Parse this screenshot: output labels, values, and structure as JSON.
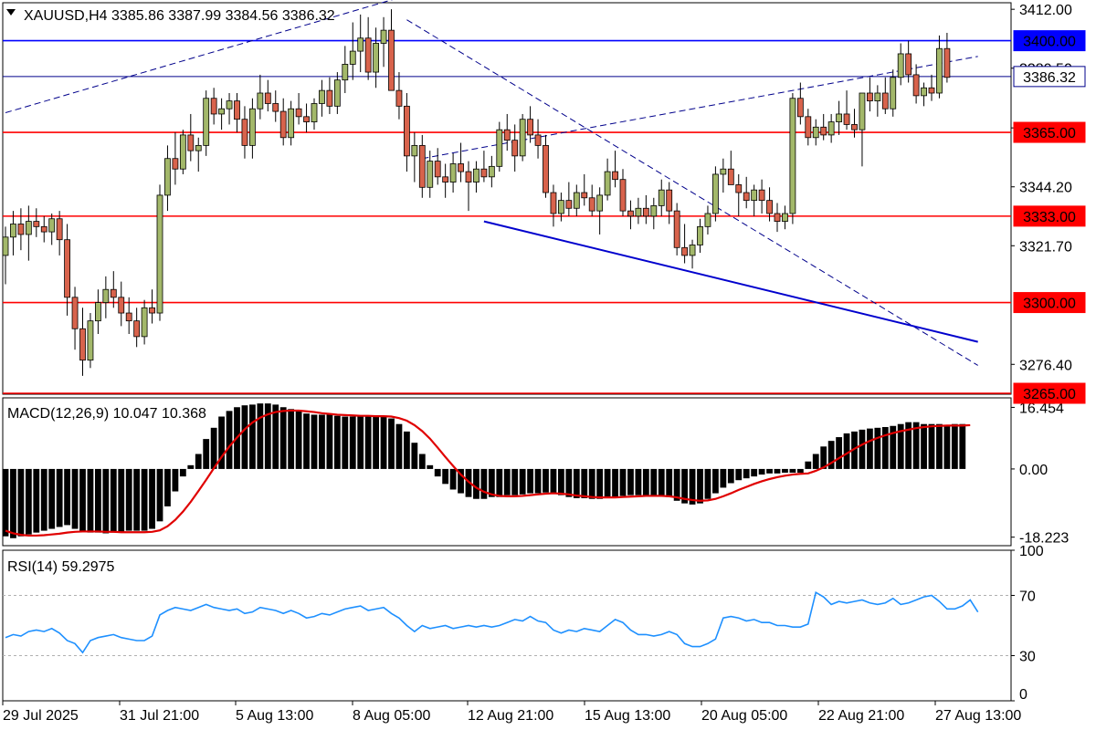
{
  "header": {
    "symbol_text": "XAUUSD,H4  3385.86 3387.99 3384.56 3386.32",
    "menu_icon": "triangle-down-icon"
  },
  "colors": {
    "bull_candle": "#a3b86a",
    "bear_candle": "#d8634c",
    "candle_outline": "#000000",
    "support_resistance_line": "#ff0000",
    "level_3400_line": "#0000ff",
    "current_price_line": "#00008b",
    "trendline": "#0000cd",
    "channel_dashed": "#00008b",
    "macd_histogram": "#000000",
    "macd_signal": "#e00000",
    "rsi_line": "#1e90ff",
    "price_label_red": "#ff0000",
    "price_label_blue": "#0000ff",
    "price_label_current": "#00008b"
  },
  "chart_data": [
    {
      "type": "candlestick",
      "title": "",
      "y_axis": {
        "min": 3265.0,
        "max": 3414.5,
        "ticks": [
          "3412.00",
          "3389.50",
          "3366.70",
          "3344.20",
          "3321.70",
          "3276.40"
        ]
      },
      "x_axis": {
        "ticks": [
          "29 Jul 2025",
          "31 Jul 21:00",
          "5 Aug 13:00",
          "8 Aug 05:00",
          "12 Aug 21:00",
          "15 Aug 13:00",
          "20 Aug 05:00",
          "22 Aug 21:00",
          "27 Aug 13:00"
        ]
      },
      "horizontal_levels": [
        {
          "label": "3400.00",
          "value": 3400.0,
          "kind": "blue"
        },
        {
          "label": "3386.32",
          "value": 3386.32,
          "kind": "current"
        },
        {
          "label": "3365.00",
          "value": 3365.0,
          "kind": "red"
        },
        {
          "label": "3333.00",
          "value": 3333.0,
          "kind": "red"
        },
        {
          "label": "3300.00",
          "value": 3300.0,
          "kind": "red"
        },
        {
          "label": "3265.00",
          "value": 3265.0,
          "kind": "red"
        }
      ],
      "candles": [
        [
          3318,
          3329,
          3307,
          3325
        ],
        [
          3325,
          3335,
          3318,
          3330
        ],
        [
          3330,
          3336,
          3320,
          3326
        ],
        [
          3326,
          3337,
          3316,
          3331
        ],
        [
          3331,
          3336,
          3325,
          3329
        ],
        [
          3329,
          3333,
          3323,
          3327
        ],
        [
          3327,
          3334,
          3322,
          3332
        ],
        [
          3332,
          3335,
          3318,
          3324
        ],
        [
          3324,
          3330,
          3295,
          3302
        ],
        [
          3302,
          3306,
          3282,
          3290
        ],
        [
          3290,
          3298,
          3272,
          3278
        ],
        [
          3278,
          3296,
          3275,
          3293
        ],
        [
          3293,
          3305,
          3288,
          3300
        ],
        [
          3300,
          3310,
          3294,
          3305
        ],
        [
          3305,
          3312,
          3298,
          3302
        ],
        [
          3302,
          3308,
          3291,
          3296
        ],
        [
          3296,
          3302,
          3288,
          3293
        ],
        [
          3293,
          3298,
          3283,
          3287
        ],
        [
          3287,
          3301,
          3284,
          3298
        ],
        [
          3298,
          3305,
          3292,
          3296
        ],
        [
          3296,
          3345,
          3293,
          3341
        ],
        [
          3341,
          3360,
          3335,
          3355
        ],
        [
          3355,
          3365,
          3345,
          3351
        ],
        [
          3351,
          3366,
          3349,
          3364
        ],
        [
          3364,
          3372,
          3354,
          3358
        ],
        [
          3358,
          3363,
          3350,
          3360
        ],
        [
          3360,
          3381,
          3356,
          3378
        ],
        [
          3378,
          3382,
          3368,
          3372
        ],
        [
          3372,
          3378,
          3366,
          3374
        ],
        [
          3374,
          3380,
          3368,
          3377
        ],
        [
          3377,
          3380,
          3365,
          3370
        ],
        [
          3370,
          3375,
          3355,
          3360
        ],
        [
          3360,
          3378,
          3355,
          3374
        ],
        [
          3374,
          3387,
          3370,
          3380
        ],
        [
          3380,
          3385,
          3373,
          3376
        ],
        [
          3376,
          3381,
          3369,
          3373
        ],
        [
          3373,
          3378,
          3360,
          3363
        ],
        [
          3363,
          3377,
          3360,
          3374
        ],
        [
          3374,
          3380,
          3368,
          3371
        ],
        [
          3371,
          3376,
          3365,
          3369
        ],
        [
          3369,
          3378,
          3366,
          3376
        ],
        [
          3376,
          3385,
          3371,
          3381
        ],
        [
          3381,
          3386,
          3372,
          3375
        ],
        [
          3375,
          3388,
          3372,
          3385
        ],
        [
          3385,
          3398,
          3380,
          3391
        ],
        [
          3391,
          3407,
          3385,
          3396
        ],
        [
          3396,
          3410,
          3388,
          3401
        ],
        [
          3401,
          3409,
          3385,
          3388
        ],
        [
          3388,
          3405,
          3382,
          3399
        ],
        [
          3399,
          3409,
          3390,
          3404
        ],
        [
          3404,
          3412,
          3393,
          3381
        ],
        [
          3381,
          3388,
          3370,
          3375
        ],
        [
          3375,
          3380,
          3350,
          3356
        ],
        [
          3356,
          3365,
          3346,
          3360
        ],
        [
          3360,
          3364,
          3340,
          3344
        ],
        [
          3344,
          3358,
          3340,
          3354
        ],
        [
          3354,
          3359,
          3345,
          3348
        ],
        [
          3348,
          3353,
          3340,
          3346
        ],
        [
          3346,
          3357,
          3342,
          3353
        ],
        [
          3353,
          3361,
          3346,
          3350
        ],
        [
          3350,
          3354,
          3335,
          3346
        ],
        [
          3346,
          3354,
          3342,
          3351
        ],
        [
          3351,
          3358,
          3346,
          3348
        ],
        [
          3348,
          3356,
          3344,
          3352
        ],
        [
          3352,
          3369,
          3350,
          3366
        ],
        [
          3366,
          3372,
          3358,
          3362
        ],
        [
          3362,
          3368,
          3350,
          3356
        ],
        [
          3356,
          3372,
          3354,
          3370
        ],
        [
          3370,
          3375,
          3361,
          3364
        ],
        [
          3364,
          3370,
          3355,
          3360
        ],
        [
          3360,
          3364,
          3340,
          3342
        ],
        [
          3342,
          3345,
          3329,
          3334
        ],
        [
          3334,
          3342,
          3331,
          3339
        ],
        [
          3339,
          3346,
          3333,
          3336
        ],
        [
          3336,
          3345,
          3333,
          3342
        ],
        [
          3342,
          3349,
          3337,
          3340
        ],
        [
          3340,
          3345,
          3333,
          3335
        ],
        [
          3335,
          3344,
          3326,
          3341
        ],
        [
          3341,
          3355,
          3339,
          3350
        ],
        [
          3350,
          3358,
          3344,
          3347
        ],
        [
          3347,
          3351,
          3333,
          3335
        ],
        [
          3335,
          3339,
          3328,
          3333
        ],
        [
          3333,
          3340,
          3330,
          3336
        ],
        [
          3336,
          3341,
          3330,
          3333
        ],
        [
          3333,
          3340,
          3328,
          3337
        ],
        [
          3337,
          3347,
          3333,
          3343
        ],
        [
          3343,
          3346,
          3330,
          3335
        ],
        [
          3335,
          3338,
          3318,
          3321
        ],
        [
          3321,
          3330,
          3315,
          3318
        ],
        [
          3318,
          3324,
          3313,
          3322
        ],
        [
          3322,
          3332,
          3319,
          3329
        ],
        [
          3329,
          3337,
          3326,
          3334
        ],
        [
          3334,
          3352,
          3331,
          3349
        ],
        [
          3349,
          3355,
          3342,
          3351
        ],
        [
          3351,
          3358,
          3346,
          3345
        ],
        [
          3345,
          3349,
          3333,
          3342
        ],
        [
          3342,
          3348,
          3336,
          3339
        ],
        [
          3339,
          3345,
          3333,
          3343
        ],
        [
          3343,
          3347,
          3334,
          3339
        ],
        [
          3339,
          3344,
          3331,
          3334
        ],
        [
          3334,
          3338,
          3327,
          3331
        ],
        [
          3331,
          3337,
          3328,
          3334
        ],
        [
          3334,
          3380,
          3330,
          3378
        ],
        [
          3378,
          3384,
          3368,
          3371
        ],
        [
          3371,
          3374,
          3360,
          3363
        ],
        [
          3363,
          3370,
          3360,
          3367
        ],
        [
          3367,
          3372,
          3362,
          3364
        ],
        [
          3364,
          3372,
          3361,
          3369
        ],
        [
          3369,
          3377,
          3364,
          3372
        ],
        [
          3372,
          3381,
          3366,
          3368
        ],
        [
          3368,
          3374,
          3363,
          3366
        ],
        [
          3366,
          3372,
          3352,
          3380
        ],
        [
          3380,
          3386,
          3373,
          3377
        ],
        [
          3377,
          3383,
          3371,
          3380
        ],
        [
          3380,
          3386,
          3372,
          3374
        ],
        [
          3374,
          3389,
          3371,
          3386
        ],
        [
          3386,
          3399,
          3383,
          3395
        ],
        [
          3395,
          3400,
          3384,
          3387
        ],
        [
          3387,
          3391,
          3376,
          3379
        ],
        [
          3379,
          3384,
          3375,
          3382
        ],
        [
          3382,
          3387,
          3377,
          3380
        ],
        [
          3380,
          3402,
          3378,
          3397
        ],
        [
          3397,
          3403,
          3384,
          3386
        ]
      ]
    },
    {
      "type": "bar",
      "title": "MACD(12,26,9) 10.047 10.368",
      "y_axis": {
        "ticks": [
          "16.454",
          "0.00",
          "-18.223"
        ],
        "min": -20.5,
        "max": 19.0
      },
      "histogram": [
        -18,
        -18.5,
        -18,
        -17.5,
        -17,
        -16.5,
        -16,
        -15.5,
        -15,
        -16,
        -16.5,
        -17,
        -17,
        -17.2,
        -17,
        -16.8,
        -16.5,
        -16.5,
        -16.5,
        -16,
        -14,
        -10,
        -6,
        -2,
        1,
        4,
        8,
        11,
        14,
        15.5,
        16.5,
        17,
        17.2,
        17.5,
        17.5,
        17.2,
        16.5,
        16,
        15.5,
        14.8,
        14.5,
        14.5,
        14.5,
        14.2,
        14,
        14,
        14,
        14,
        14,
        14,
        13.5,
        12,
        10,
        7,
        4,
        1,
        -2,
        -4,
        -5.5,
        -6.5,
        -7.5,
        -8,
        -8,
        -7.5,
        -7.5,
        -7,
        -7,
        -6.8,
        -6.5,
        -6.5,
        -6.3,
        -6.5,
        -7,
        -7.5,
        -7.8,
        -7.8,
        -8,
        -8,
        -7.8,
        -7.5,
        -7.2,
        -7,
        -7,
        -7,
        -7,
        -7.2,
        -7.5,
        -8.5,
        -9.2,
        -9.5,
        -9.2,
        -8,
        -6.5,
        -5,
        -3.8,
        -3,
        -2.5,
        -2,
        -1.5,
        -1.2,
        -1.2,
        -1,
        -1,
        -1,
        2,
        4,
        6,
        7.5,
        8.5,
        9.5,
        10,
        10.5,
        10.8,
        11,
        11.2,
        11.5,
        12,
        12.5,
        12.5,
        12,
        12,
        12,
        11.5,
        12,
        12
      ],
      "signal": [
        -16.5,
        -17.2,
        -17.6,
        -17.8,
        -17.8,
        -17.7,
        -17.5,
        -17.3,
        -17.0,
        -16.8,
        -16.7,
        -16.7,
        -16.7,
        -16.8,
        -16.8,
        -16.9,
        -16.9,
        -16.9,
        -16.9,
        -16.8,
        -16.4,
        -15.3,
        -13.6,
        -11.4,
        -8.8,
        -5.9,
        -2.9,
        0.2,
        3.2,
        6.0,
        8.4,
        10.6,
        12.4,
        13.7,
        14.6,
        15.2,
        15.5,
        15.6,
        15.6,
        15.4,
        15.2,
        14.9,
        14.7,
        14.5,
        14.4,
        14.3,
        14.2,
        14.2,
        14.1,
        14.1,
        14.0,
        13.6,
        12.9,
        11.7,
        10.1,
        8.1,
        5.7,
        3.2,
        0.8,
        -1.5,
        -3.4,
        -5.0,
        -6.1,
        -6.8,
        -7.2,
        -7.3,
        -7.3,
        -7.2,
        -7.0,
        -6.8,
        -6.6,
        -6.5,
        -6.6,
        -6.8,
        -7.1,
        -7.3,
        -7.5,
        -7.6,
        -7.6,
        -7.6,
        -7.5,
        -7.4,
        -7.3,
        -7.2,
        -7.2,
        -7.2,
        -7.3,
        -7.6,
        -8.0,
        -8.3,
        -8.5,
        -8.4,
        -8.0,
        -7.3,
        -6.5,
        -5.6,
        -4.8,
        -4.0,
        -3.3,
        -2.7,
        -2.2,
        -1.8,
        -1.5,
        -1.3,
        -1.2,
        -0.5,
        0.4,
        1.6,
        2.9,
        4.1,
        5.4,
        6.5,
        7.5,
        8.3,
        9.0,
        9.6,
        10.1,
        10.5,
        10.9,
        11.2,
        11.4,
        11.5,
        11.6,
        11.6,
        11.6,
        11.7
      ]
    },
    {
      "type": "line",
      "title": "RSI(14) 59.2975",
      "y_axis": {
        "ticks": [
          "100",
          "70",
          "30",
          "0"
        ],
        "min": 0,
        "max": 100
      },
      "levels": [
        70,
        30
      ],
      "values": [
        42,
        44,
        43,
        46,
        47,
        46,
        48,
        45,
        40,
        38,
        32,
        40,
        42,
        43,
        44,
        42,
        41,
        40,
        40,
        43,
        57,
        60,
        62,
        61,
        60,
        62,
        64,
        62,
        61,
        60,
        61,
        58,
        59,
        62,
        61,
        60,
        58,
        60,
        58,
        55,
        56,
        58,
        57,
        59,
        61,
        62,
        63,
        60,
        61,
        62,
        58,
        55,
        50,
        46,
        50,
        48,
        49,
        50,
        48,
        49,
        50,
        49,
        50,
        49,
        50,
        52,
        54,
        53,
        56,
        53,
        52,
        47,
        45,
        47,
        46,
        48,
        47,
        46,
        50,
        54,
        52,
        47,
        44,
        44,
        43,
        44,
        46,
        44,
        38,
        36,
        36,
        38,
        41,
        55,
        56,
        55,
        53,
        54,
        52,
        52,
        50,
        50,
        49,
        49,
        51,
        72,
        69,
        64,
        66,
        65,
        66,
        67,
        65,
        64,
        65,
        68,
        64,
        65,
        67,
        69,
        70,
        66,
        61,
        61,
        63,
        67,
        59
      ]
    }
  ],
  "axes": {
    "price_labels": [
      "3412.00",
      "3389.50",
      "3366.70",
      "3344.20",
      "3321.70",
      "3276.40"
    ],
    "macd_labels": [
      "16.454",
      "0.00",
      "-18.223"
    ],
    "rsi_labels": [
      "100",
      "70",
      "30",
      "0"
    ],
    "time_labels": [
      "29 Jul 2025",
      "31 Jul 21:00",
      "5 Aug 13:00",
      "8 Aug 05:00",
      "12 Aug 21:00",
      "15 Aug 13:00",
      "20 Aug 05:00",
      "22 Aug 21:00",
      "27 Aug 13:00"
    ]
  },
  "drawings": {
    "trendlines": [
      {
        "from": {
          "bar": 0,
          "price": 3372.5
        },
        "to": {
          "bar": 54,
          "price": 3419.0
        }
      },
      {
        "from": {
          "bar": 54,
          "price": 3355.0
        },
        "to": {
          "bar": 126,
          "price": 3394.0
        }
      },
      {
        "from": {
          "bar": 52,
          "price": 3408.0
        },
        "to": {
          "bar": 126,
          "price": 3276.0
        }
      }
    ],
    "support_line": {
      "from": {
        "bar": 62,
        "price": 3331.0
      },
      "to": {
        "bar": 126,
        "price": 3285.0
      }
    }
  }
}
